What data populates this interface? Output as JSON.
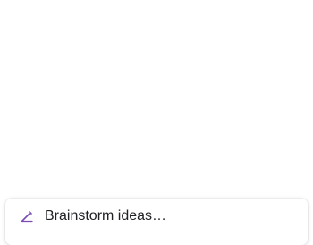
{
  "suggestions": {
    "items": [
      {
        "icon": "pen-icon",
        "icon_color": "#7b4bb3",
        "label": "Brainstorm ideas…"
      }
    ]
  }
}
